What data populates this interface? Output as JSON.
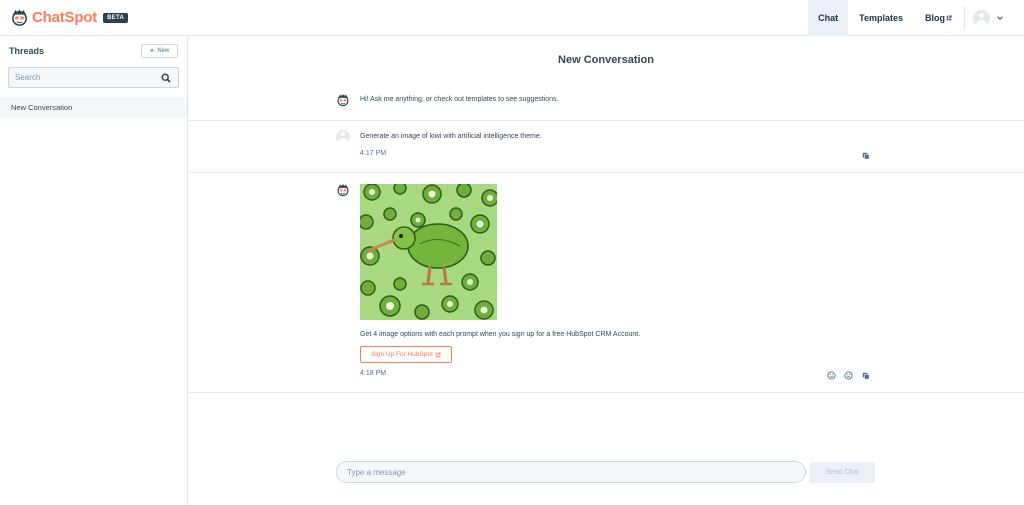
{
  "header": {
    "logo_text": "ChatSpot",
    "beta_label": "BETA",
    "nav": {
      "chat": "Chat",
      "templates": "Templates",
      "blog": "Blog"
    }
  },
  "sidebar": {
    "title": "Threads",
    "new_button": "New",
    "search_placeholder": "Search",
    "threads": [
      {
        "label": "New Conversation"
      }
    ]
  },
  "conversation": {
    "title": "New Conversation",
    "messages": [
      {
        "role": "bot",
        "text": "Hi! Ask me anything, or check out templates to see suggestions."
      },
      {
        "role": "user",
        "text": "Generate an image of kiwi with artificial intelligence theme.",
        "time": "4:17 PM"
      },
      {
        "role": "bot",
        "image": "kiwi-bird-illustration",
        "text": "Get 4 image options with each prompt when you sign up for a free HubSpot CRM Account.",
        "button": "Sign Up For HubSpot",
        "time": "4:18 PM"
      }
    ]
  },
  "composer": {
    "placeholder": "Type a message",
    "send_label": "Send Chat"
  },
  "colors": {
    "brand": "#ff7a59",
    "navy": "#2d3e50",
    "text": "#33475b"
  }
}
